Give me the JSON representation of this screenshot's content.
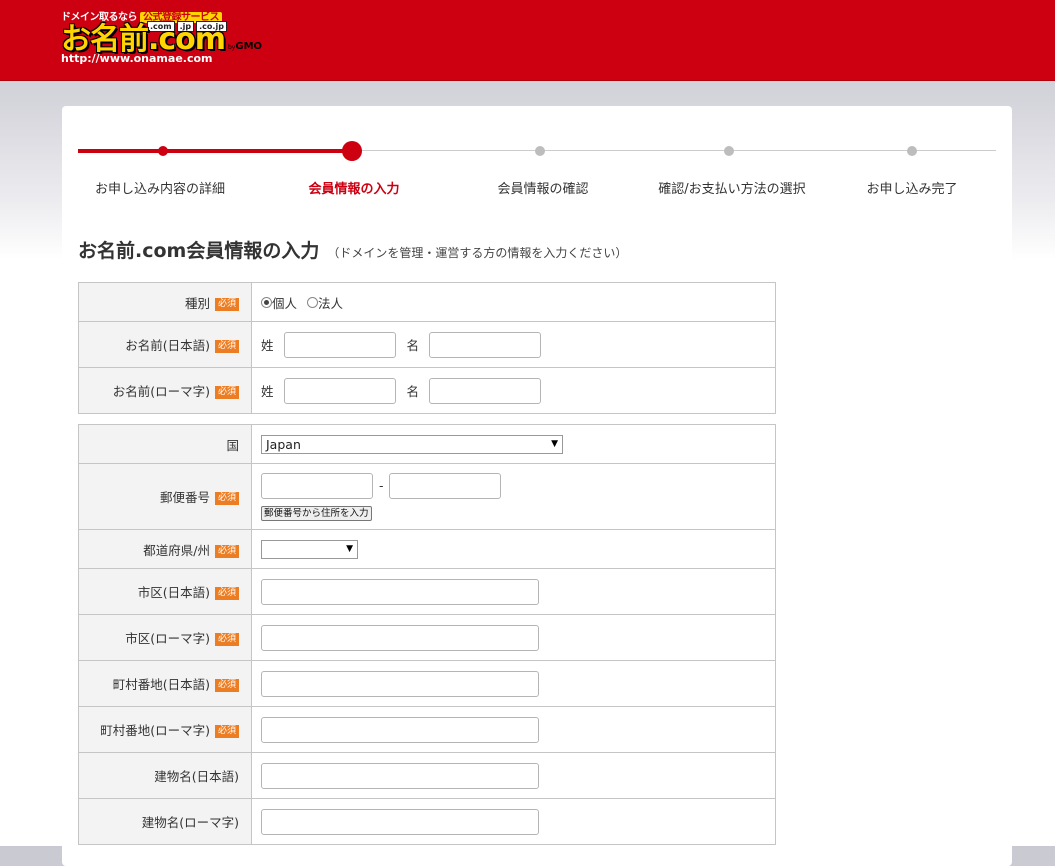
{
  "header": {
    "logo_tagline": "ドメイン取るなら",
    "logo_badge": "公式登録サービス",
    "logo_tlds": [
      ".com",
      ".jp",
      ".co.jp"
    ],
    "logo_text": "お名前.com",
    "logo_by": "by",
    "logo_gmo": "GMO",
    "logo_url": "http://www.onamae.com"
  },
  "steps": [
    {
      "label": "お申し込み内容の詳細",
      "state": "done"
    },
    {
      "label": "会員情報の入力",
      "state": "active"
    },
    {
      "label": "会員情報の確認",
      "state": "todo"
    },
    {
      "label": "確認/お支払い方法の選択",
      "state": "todo"
    },
    {
      "label": "お申し込み完了",
      "state": "todo"
    }
  ],
  "page": {
    "title": "お名前.com会員情報の入力",
    "subtitle": "（ドメインを管理・運営する方の情報を入力ください）"
  },
  "required_label": "必須",
  "form1": {
    "type_label": "種別",
    "type_options": [
      {
        "label": "個人",
        "checked": true
      },
      {
        "label": "法人",
        "checked": false
      }
    ],
    "name_jp_label": "お名前(日本語)",
    "name_roman_label": "お名前(ローマ字)",
    "sei": "姓",
    "mei": "名"
  },
  "form2": {
    "country_label": "国",
    "country_value": "Japan",
    "postal_label": "郵便番号",
    "postal_separator": "-",
    "postal_button": "郵便番号から住所を入力",
    "prefecture_label": "都道府県/州",
    "prefecture_value": "",
    "city_jp_label": "市区(日本語)",
    "city_roman_label": "市区(ローマ字)",
    "street_jp_label": "町村番地(日本語)",
    "street_roman_label": "町村番地(ローマ字)",
    "building_jp_label": "建物名(日本語)",
    "building_roman_label": "建物名(ローマ字)"
  },
  "colors": {
    "brand_red": "#cc0011",
    "required_orange": "#ed7d22",
    "logo_yellow": "#ffd400"
  },
  "icons": {
    "select_arrow": "▼"
  }
}
